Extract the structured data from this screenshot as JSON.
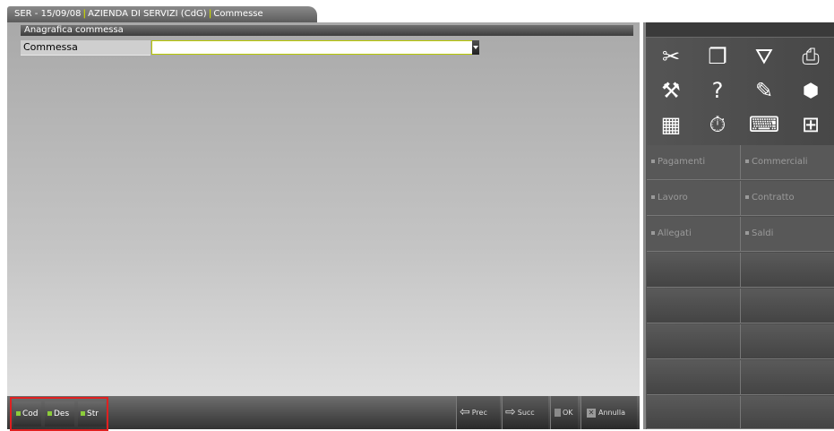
{
  "tab": {
    "part1": "SER - 15/09/08",
    "part2": "AZIENDA DI SERVIZI (CdG)",
    "part3": "Commesse"
  },
  "form": {
    "section_title": "Anagrafica commessa",
    "field_label": "Commessa",
    "field_value": ""
  },
  "bottom": {
    "fkeys": [
      "Cod",
      "Des",
      "Str"
    ],
    "prev": "Prec",
    "next": "Succ",
    "ok": "OK",
    "cancel": "Annulla"
  },
  "right_panel": {
    "icons": [
      "scissors-icon",
      "copy-icon",
      "funnel-icon",
      "printer-icon",
      "wrench-icon",
      "question-icon",
      "book-icon",
      "f-key-icon",
      "calculator-icon",
      "stopwatch-icon",
      "keyboard-icon",
      "numpad-icon"
    ],
    "buttons": [
      "Pagamenti",
      "Commerciali",
      "Lavoro",
      "Contratto",
      "Allegati",
      "Saldi"
    ]
  },
  "colors": {
    "accent": "#c8d400",
    "fkey_dot": "#8ccc3a",
    "highlight_border": "#e02020"
  }
}
